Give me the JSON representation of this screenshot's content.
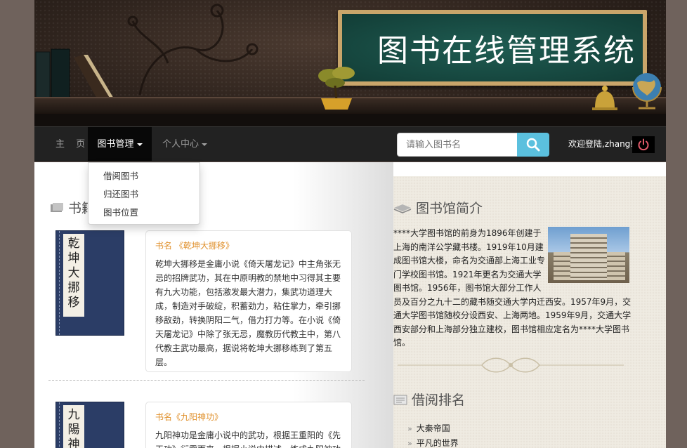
{
  "header": {
    "title": "图书在线管理系统"
  },
  "navbar": {
    "home": "主 页",
    "books_menu": "图书管理",
    "personal_menu": "个人中心",
    "search": {
      "placeholder": "请输入图书名"
    },
    "welcome": "欢迎登陆,zhang!"
  },
  "dropdown": {
    "items": [
      "借阅图书",
      "归还图书",
      "图书位置"
    ]
  },
  "books_section": {
    "title": "书籍",
    "books": [
      {
        "name": "书名 《乾坤大挪移》",
        "cover_text": "乾坤大挪移",
        "description": "乾坤大挪移是金庸小说《倚天屠龙记》中主角张无忌的招牌武功，其在中原明教的禁地中习得其主要有九大功能，包括激发最大潜力，集武功道理大成，制造对手破绽，积蓄劲力，粘住掌力，牵引挪移敌劲，转换阴阳二气，借力打力等。在小说《倚天屠龙记》中除了张无忌，魔教历代教主中，第八代教主武功最高，据说将乾坤大挪移练到了第五层。"
      },
      {
        "name": "书名《九阳神功》",
        "cover_text": "九陽神",
        "description": "九阳神功是金庸小说中的武功，根据王重阳的《先天功》衍需而来，根据小说中描述，练成九阳神功"
      }
    ]
  },
  "intro_section": {
    "title": "图书馆简介",
    "text": "****大学图书馆的前身为1896年创建于上海的南洋公学藏书楼。1919年10月建成图书馆大楼，命名为交通部上海工业专门学校图书馆。1921年更名为交通大学图书馆。1956年，图书馆大部分工作人员及百分之九十二的藏书随交通大学内迁西安。1957年9月，交通大学图书馆随校分设西安、上海两地。1959年9月，交通大学西安部分和上海部分独立建校，图书馆相应定名为****大学图书馆。"
  },
  "rank_section": {
    "title": "借阅排名",
    "items": [
      "大秦帝国",
      "平凡的世界"
    ]
  },
  "colors": {
    "nav_bg": "#222222",
    "search_button": "#5bc0de",
    "book_name": "#e0912d",
    "chalkboard": "#1f5c52"
  }
}
